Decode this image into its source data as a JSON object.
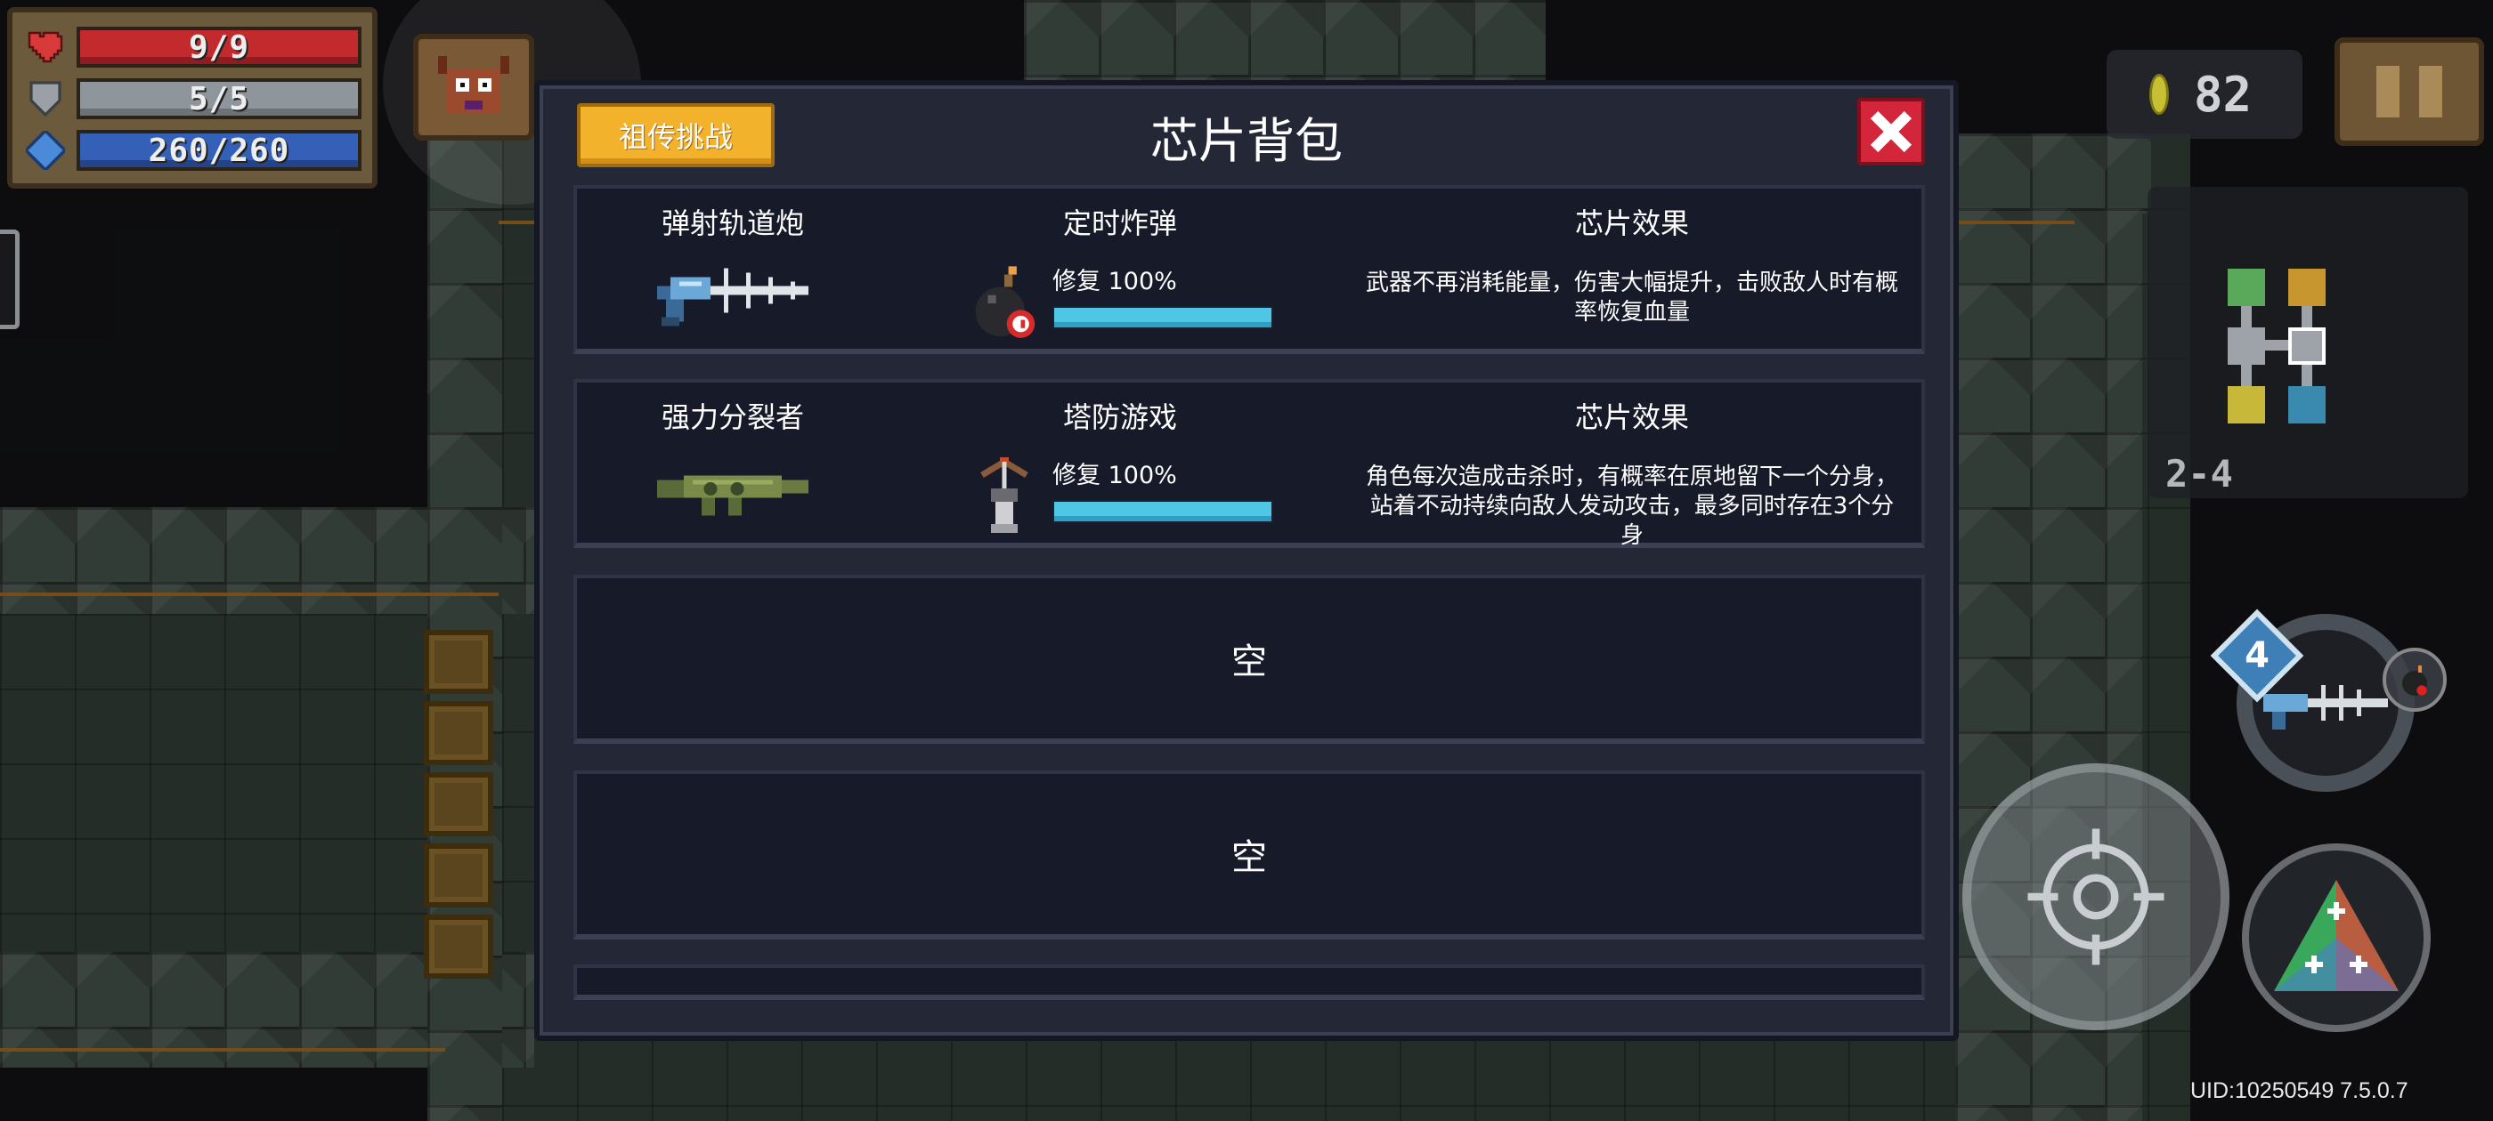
{
  "hud": {
    "hp": "9/9",
    "hp_fraction": 1.0,
    "armor": "5/5",
    "armor_fraction": 1.0,
    "energy": "260/260",
    "energy_fraction": 1.0,
    "coins": "82",
    "level": "2-4",
    "weapon_energy_cost": "4",
    "uid": "UID:10250549 7.5.0.7",
    "colors": {
      "hp": "#c22a2e",
      "armor": "#8e969c",
      "energy": "#3460b8",
      "progress": "#4fc6e6",
      "accent_button": "#f2b22c",
      "close_button": "#d3263a"
    }
  },
  "modal": {
    "title": "芯片背包",
    "legacy_challenge_label": "祖传挑战",
    "close_icon": "close-x-icon",
    "slots": [
      {
        "weapon_name": "弹射轨道炮",
        "weapon_icon": "railgun-icon",
        "chip_name": "定时炸弹",
        "chip_icon": "time-bomb-icon",
        "repair_text": "修复 100%",
        "repair_fraction": 1.0,
        "effect_header": "芯片效果",
        "effect_desc": "武器不再消耗能量，伤害大幅提升，击败敌人时有概率恢复血量"
      },
      {
        "weapon_name": "强力分裂者",
        "weapon_icon": "splitter-rifle-icon",
        "chip_name": "塔防游戏",
        "chip_icon": "crossbow-turret-icon",
        "repair_text": "修复 100%",
        "repair_fraction": 1.0,
        "effect_header": "芯片效果",
        "effect_desc": "角色每次造成击杀时，有概率在原地留下一个分身，站着不动持续向敌人发动攻击，最多同时存在3个分身"
      },
      {
        "empty_label": "空"
      },
      {
        "empty_label": "空"
      }
    ]
  }
}
